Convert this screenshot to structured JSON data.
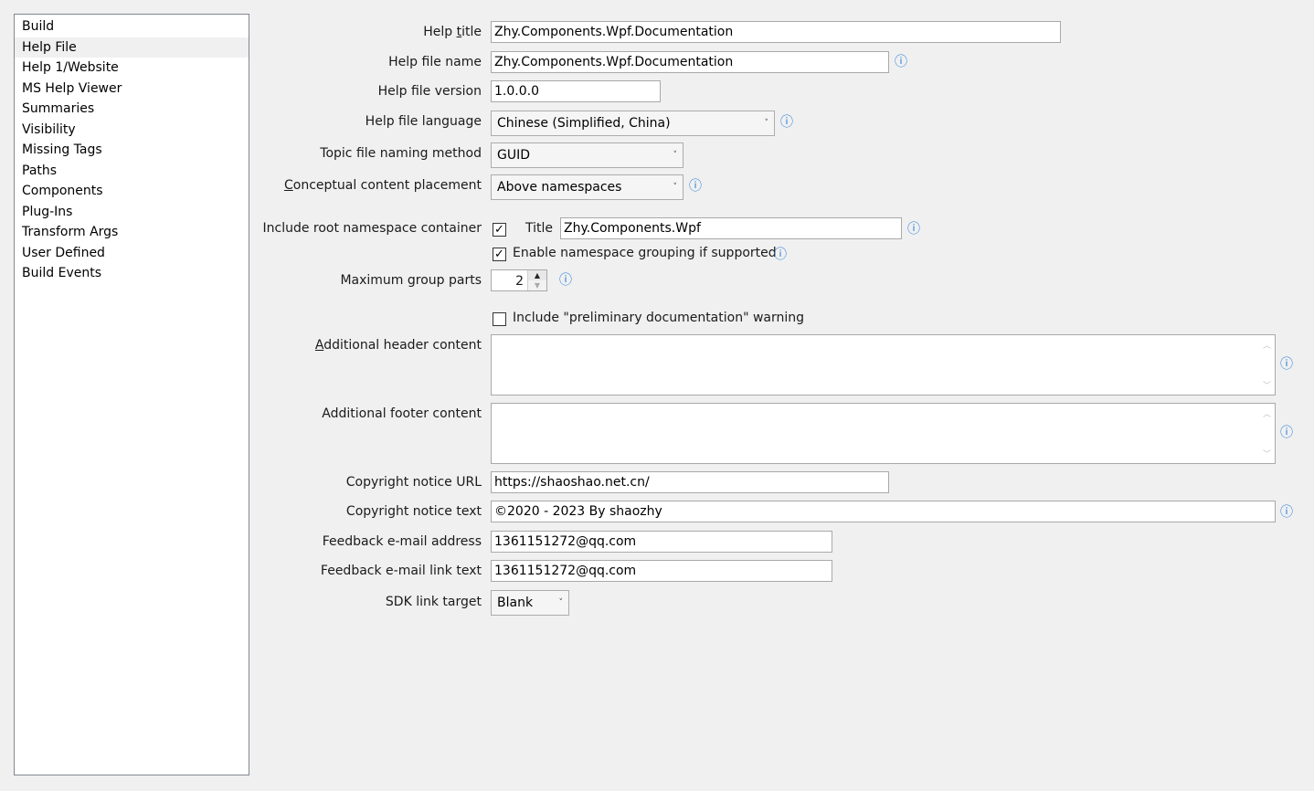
{
  "sidebar": {
    "items": [
      {
        "label": "Build"
      },
      {
        "label": "Help File",
        "selected": true
      },
      {
        "label": "Help 1/Website"
      },
      {
        "label": "MS Help Viewer"
      },
      {
        "label": "Summaries"
      },
      {
        "label": "Visibility"
      },
      {
        "label": "Missing Tags"
      },
      {
        "label": "Paths"
      },
      {
        "label": "Components"
      },
      {
        "label": "Plug-Ins"
      },
      {
        "label": "Transform Args"
      },
      {
        "label": "User Defined"
      },
      {
        "label": "Build Events"
      }
    ]
  },
  "form": {
    "help_title": {
      "pre": "Help ",
      "u": "t",
      "post": "itle",
      "value": "Zhy.Components.Wpf.Documentation"
    },
    "help_file_name": {
      "label": "Help file name",
      "value": "Zhy.Components.Wpf.Documentation"
    },
    "help_file_version": {
      "label": "Help file version",
      "value": "1.0.0.0"
    },
    "help_file_language": {
      "label": "Help file language",
      "value": "Chinese (Simplified, China)"
    },
    "topic_naming": {
      "label": "Topic file naming method",
      "value": "GUID"
    },
    "conceptual_placement": {
      "u": "C",
      "post": "onceptual content placement",
      "value": "Above namespaces"
    },
    "root_namespace": {
      "label": "Include root namespace container",
      "checked": true,
      "title_label": "Title",
      "title_value": "Zhy.Components.Wpf"
    },
    "namespace_grouping": {
      "label": "Enable namespace grouping if supported",
      "checked": true
    },
    "max_group_parts": {
      "label": "Maximum group parts",
      "value": "2"
    },
    "preliminary": {
      "label": "Include \"preliminary documentation\" warning",
      "checked": false
    },
    "header_content": {
      "u": "A",
      "post": "dditional header content",
      "value": ""
    },
    "footer_content": {
      "label": "Additional footer content",
      "value": ""
    },
    "copyright_url": {
      "label": "Copyright notice URL",
      "value": "https://shaoshao.net.cn/"
    },
    "copyright_text": {
      "label": "Copyright notice text",
      "value": "©2020 - 2023 By shaozhy"
    },
    "feedback_email": {
      "label": "Feedback e-mail address",
      "value": "1361151272@qq.com"
    },
    "feedback_link": {
      "label": "Feedback e-mail link text",
      "value": "1361151272@qq.com"
    },
    "sdk_link_target": {
      "label": "SDK link target",
      "value": "Blank"
    }
  },
  "icons": {
    "info": "info-icon",
    "dropdown": "chevron-down-icon",
    "check": "checkmark-icon"
  },
  "colors": {
    "info": "#1e78d7",
    "selected_row": "#f0f0f0",
    "background": "#f0f0f0"
  }
}
